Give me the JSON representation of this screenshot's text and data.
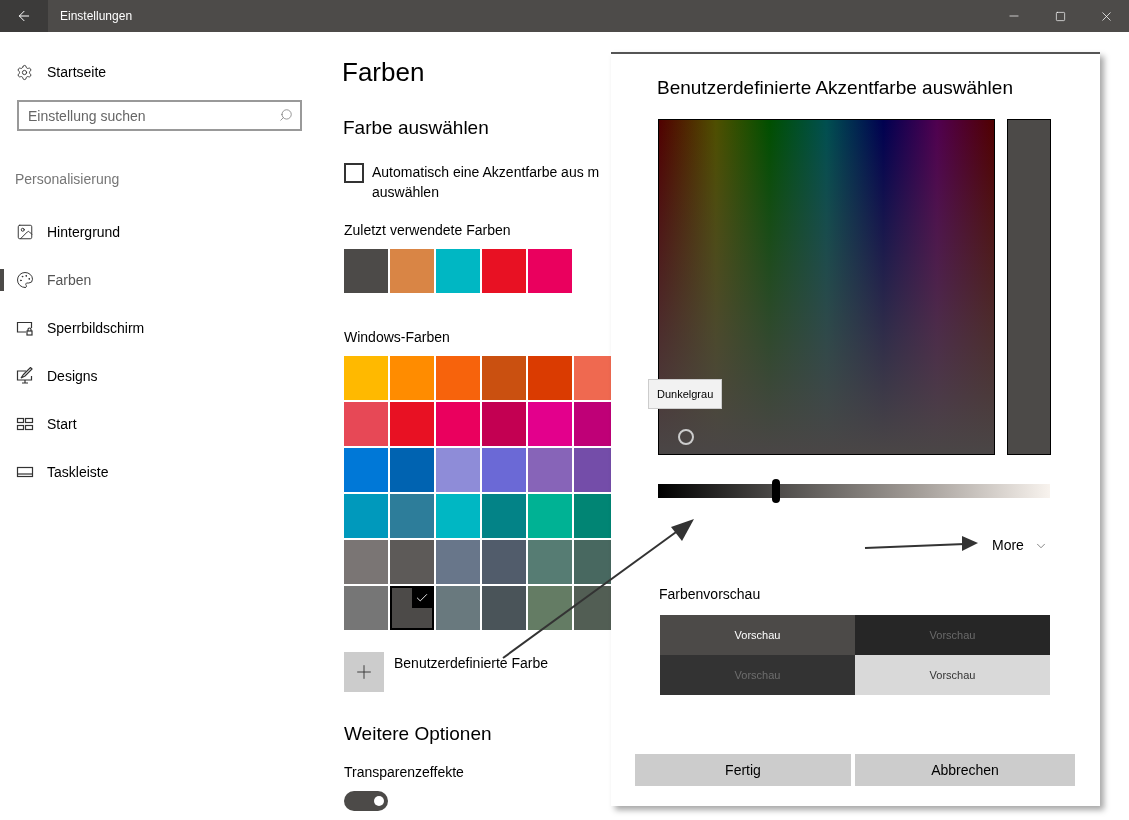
{
  "window": {
    "title": "Einstellungen"
  },
  "sidebar": {
    "home": "Startseite",
    "search": {
      "placeholder": "Einstellung suchen"
    },
    "section": "Personalisierung",
    "items": [
      {
        "label": "Hintergrund",
        "selected": false
      },
      {
        "label": "Farben",
        "selected": true
      },
      {
        "label": "Sperrbildschirm",
        "selected": false
      },
      {
        "label": "Designs",
        "selected": false
      },
      {
        "label": "Start",
        "selected": false
      },
      {
        "label": "Taskleiste",
        "selected": false
      }
    ]
  },
  "content": {
    "title": "Farben",
    "choose_heading": "Farbe auswählen",
    "auto_accent": {
      "label_lines": [
        "Automatisch eine Akzentfarbe aus m",
        "auswählen"
      ],
      "checked": false
    },
    "recent": {
      "label": "Zuletzt verwendete Farben",
      "swatches": [
        {
          "color": "#4c4a48"
        },
        {
          "color": "#d98545"
        },
        {
          "color": "#00b7c3"
        },
        {
          "color": "#e81123"
        },
        {
          "color": "#ea005e"
        }
      ]
    },
    "windows_colors": {
      "label": "Windows-Farben",
      "swatches": [
        {
          "color": "#ffb900",
          "selected": false
        },
        {
          "color": "#ff8c00",
          "selected": false
        },
        {
          "color": "#f7630c",
          "selected": false
        },
        {
          "color": "#ca5010",
          "selected": false
        },
        {
          "color": "#da3b01",
          "selected": false
        },
        {
          "color": "#ef6950",
          "selected": false
        },
        {
          "color": "#e74856",
          "selected": false
        },
        {
          "color": "#e81123",
          "selected": false
        },
        {
          "color": "#ea005e",
          "selected": false
        },
        {
          "color": "#c30052",
          "selected": false
        },
        {
          "color": "#e3008c",
          "selected": false
        },
        {
          "color": "#bf0077",
          "selected": false
        },
        {
          "color": "#0078d7",
          "selected": false
        },
        {
          "color": "#0063b1",
          "selected": false
        },
        {
          "color": "#8e8cd8",
          "selected": false
        },
        {
          "color": "#6b69d6",
          "selected": false
        },
        {
          "color": "#8764b8",
          "selected": false
        },
        {
          "color": "#744da9",
          "selected": false
        },
        {
          "color": "#0099bc",
          "selected": false
        },
        {
          "color": "#2d7d9a",
          "selected": false
        },
        {
          "color": "#00b7c3",
          "selected": false
        },
        {
          "color": "#038387",
          "selected": false
        },
        {
          "color": "#00b294",
          "selected": false
        },
        {
          "color": "#018574",
          "selected": false
        },
        {
          "color": "#7a7574",
          "selected": false
        },
        {
          "color": "#5d5a58",
          "selected": false
        },
        {
          "color": "#68768a",
          "selected": false
        },
        {
          "color": "#515c6b",
          "selected": false
        },
        {
          "color": "#567c73",
          "selected": false
        },
        {
          "color": "#486860",
          "selected": false
        },
        {
          "color": "#767676",
          "selected": false
        },
        {
          "color": "#4c4a48",
          "selected": true
        },
        {
          "color": "#69797e",
          "selected": false
        },
        {
          "color": "#4a5459",
          "selected": false
        },
        {
          "color": "#647c64",
          "selected": false
        },
        {
          "color": "#525e54",
          "selected": false
        }
      ]
    },
    "custom_color": {
      "label": "Benutzerdefinierte Farbe"
    },
    "more_heading": "Weitere Optionen",
    "transparency": {
      "label": "Transparenzeffekte",
      "on": true
    }
  },
  "dialog": {
    "title": "Benutzerdefinierte Akzentfarbe auswählen",
    "tooltip": "Dunkelgrau",
    "color": "#4c4a48",
    "brightness": {
      "level": 0.3
    },
    "more": "More",
    "preview": {
      "label": "Farbenvorschau",
      "cells": [
        {
          "text": "Vorschau",
          "color": "#4c4a48"
        },
        {
          "text": "Vorschau",
          "color": "#262626"
        },
        {
          "text": "Vorschau",
          "color": "#333333"
        },
        {
          "text": "Vorschau",
          "color": "#d9d9d9"
        }
      ]
    },
    "buttons": [
      "Fertig",
      "Abbrechen"
    ]
  }
}
